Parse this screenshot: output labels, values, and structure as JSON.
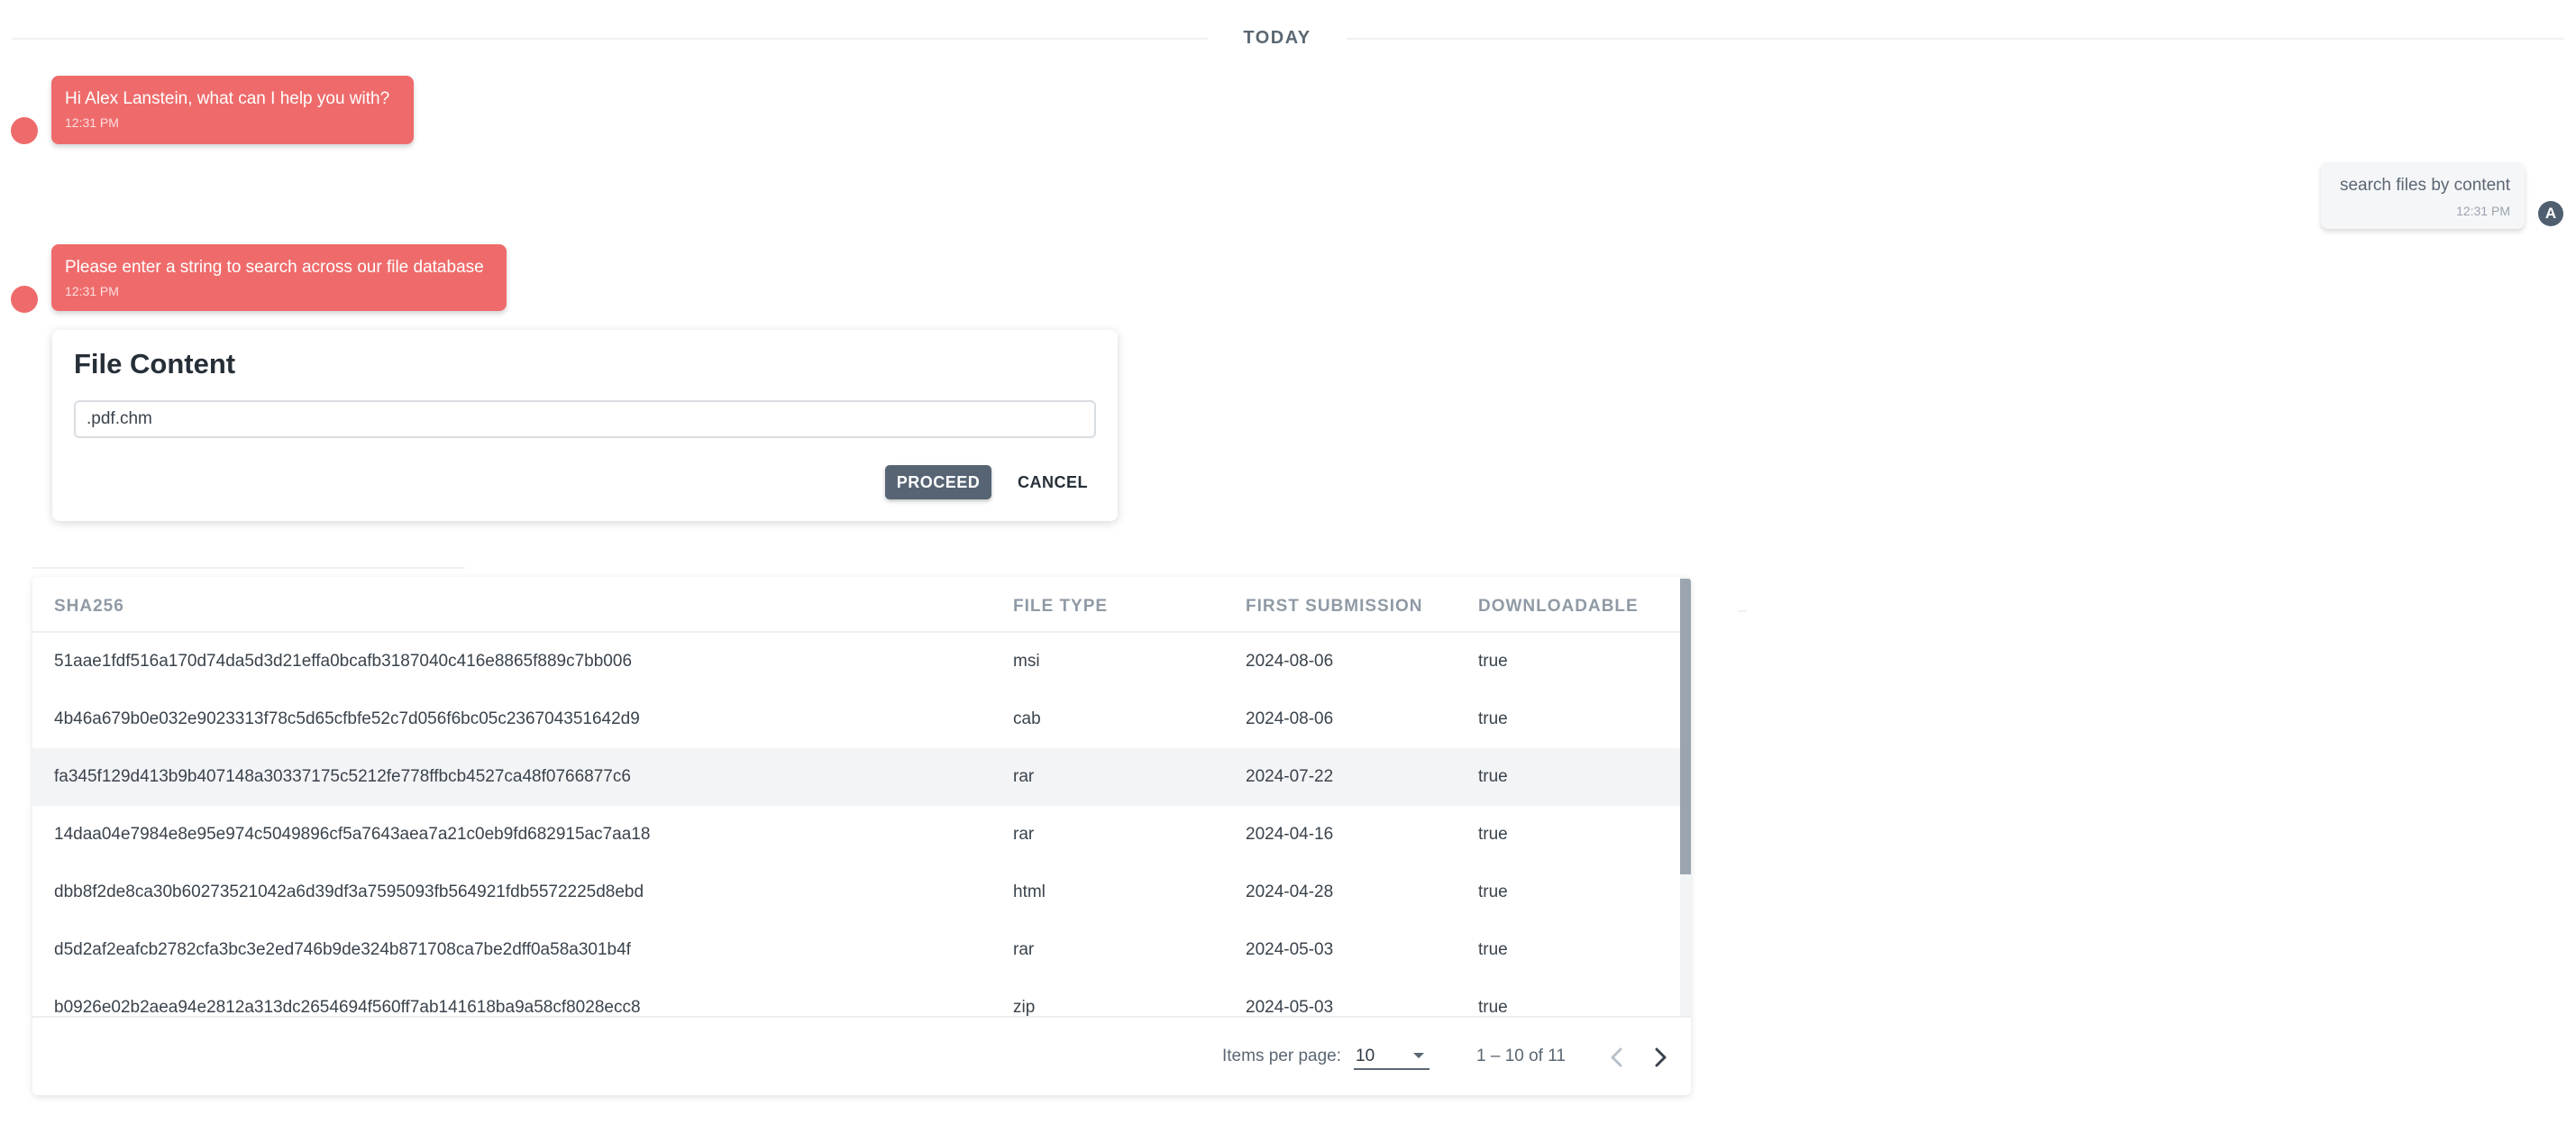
{
  "divider": {
    "label": "TODAY"
  },
  "chat": [
    {
      "from": "bot",
      "text": "Hi Alex Lanstein, what can I help you with?",
      "time": "12:31 PM"
    },
    {
      "from": "user",
      "text": "search files by content",
      "time": "12:31 PM",
      "avatar_letter": "A"
    },
    {
      "from": "bot",
      "text": "Please enter a string to search across our file database",
      "time": "12:31 PM"
    }
  ],
  "file_content_form": {
    "title": "File Content",
    "input_value": ".pdf.chm",
    "proceed_label": "PROCEED",
    "cancel_label": "CANCEL"
  },
  "results_table": {
    "columns": [
      "SHA256",
      "FILE TYPE",
      "FIRST SUBMISSION",
      "DOWNLOADABLE"
    ],
    "rows": [
      {
        "sha256": "51aae1fdf516a170d74da5d3d21effa0bcafb3187040c416e8865f889c7bb006",
        "file_type": "msi",
        "first_submission": "2024-08-06",
        "downloadable": "true"
      },
      {
        "sha256": "4b46a679b0e032e9023313f78c5d65cfbfe52c7d056f6bc05c236704351642d9",
        "file_type": "cab",
        "first_submission": "2024-08-06",
        "downloadable": "true"
      },
      {
        "sha256": "fa345f129d413b9b407148a30337175c5212fe778ffbcb4527ca48f0766877c6",
        "file_type": "rar",
        "first_submission": "2024-07-22",
        "downloadable": "true",
        "highlighted": true
      },
      {
        "sha256": "14daa04e7984e8e95e974c5049896cf5a7643aea7a21c0eb9fd682915ac7aa18",
        "file_type": "rar",
        "first_submission": "2024-04-16",
        "downloadable": "true"
      },
      {
        "sha256": "dbb8f2de8ca30b60273521042a6d39df3a7595093fb564921fdb5572225d8ebd",
        "file_type": "html",
        "first_submission": "2024-04-28",
        "downloadable": "true"
      },
      {
        "sha256": "d5d2af2eafcb2782cfa3bc3e2ed746b9de324b871708ca7be2dff0a58a301b4f",
        "file_type": "rar",
        "first_submission": "2024-05-03",
        "downloadable": "true"
      },
      {
        "sha256": "b0926e02b2aea94e2812a313dc2654694f560ff7ab141618ba9a58cf8028ecc8",
        "file_type": "zip",
        "first_submission": "2024-05-03",
        "downloadable": "true"
      }
    ],
    "paginator": {
      "items_per_page_label": "Items per page:",
      "items_per_page_value": "10",
      "range_label": "1 – 10 of 11"
    }
  },
  "colors": {
    "bot_bubble": "#ef6b6b",
    "user_bubble": "#f5f6f8",
    "primary_button": "#566474",
    "user_avatar": "#4f5f70"
  },
  "icons": {
    "prev": "chevron-left-icon",
    "next": "chevron-right-icon",
    "select_caret": "caret-down-icon"
  }
}
